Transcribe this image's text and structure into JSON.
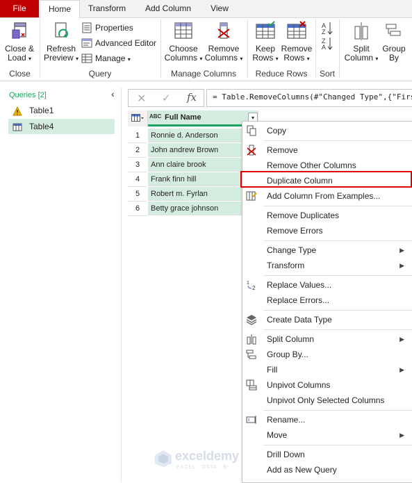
{
  "tabs": [
    "File",
    "Home",
    "Transform",
    "Add Column",
    "View"
  ],
  "ribbon": {
    "close_group": {
      "button": "Close &",
      "button2": "Load",
      "label": "Close"
    },
    "query_group": {
      "refresh": "Refresh",
      "refresh2": "Preview",
      "properties": "Properties",
      "advanced_editor": "Advanced Editor",
      "manage": "Manage",
      "label": "Query"
    },
    "manage_columns_group": {
      "choose": "Choose",
      "choose2": "Columns",
      "remove": "Remove",
      "remove2": "Columns",
      "label": "Manage Columns"
    },
    "reduce_rows_group": {
      "keep": "Keep",
      "keep2": "Rows",
      "remove": "Remove",
      "remove2": "Rows",
      "label": "Reduce Rows"
    },
    "sort_group": {
      "label": "Sort"
    },
    "split_group": {
      "split": "Split",
      "split2": "Column",
      "group": "Group",
      "group2": "By"
    }
  },
  "queries": {
    "header": "Queries [2]",
    "items": [
      "Table1",
      "Table4"
    ]
  },
  "formula": {
    "fx": "fx",
    "text": "= Table.RemoveColumns(#\"Changed Type\",{\"Firs"
  },
  "grid": {
    "type_badge": "ABC",
    "column_header": "Full Name",
    "rows": [
      {
        "n": "1",
        "v": "Ronnie d. Anderson"
      },
      {
        "n": "2",
        "v": "John andrew Brown"
      },
      {
        "n": "3",
        "v": "Ann claire brook"
      },
      {
        "n": "4",
        "v": "Frank finn hill"
      },
      {
        "n": "5",
        "v": "Robert m. Fyrlan"
      },
      {
        "n": "6",
        "v": "Betty grace johnson"
      }
    ]
  },
  "context_menu": {
    "copy": "Copy",
    "remove": "Remove",
    "remove_other": "Remove Other Columns",
    "duplicate": "Duplicate Column",
    "add_from_examples": "Add Column From Examples...",
    "remove_duplicates": "Remove Duplicates",
    "remove_errors": "Remove Errors",
    "change_type": "Change Type",
    "transform": "Transform",
    "replace_values": "Replace Values...",
    "replace_errors": "Replace Errors...",
    "create_data_type": "Create Data Type",
    "split_column": "Split Column",
    "group_by": "Group By...",
    "fill": "Fill",
    "unpivot": "Unpivot Columns",
    "unpivot_selected": "Unpivot Only Selected Columns",
    "rename": "Rename...",
    "move": "Move",
    "drill_down": "Drill Down",
    "add_as_new_query": "Add as New Query"
  },
  "watermark": {
    "name": "exceldemy",
    "tagline": "EXCEL · DATA · BI"
  },
  "colors": {
    "file_tab": "#c00000",
    "selected_query": "#d5ede0",
    "column_header": "#d5ede0",
    "highlight": "#e00000",
    "accent_green": "#1aa260"
  }
}
